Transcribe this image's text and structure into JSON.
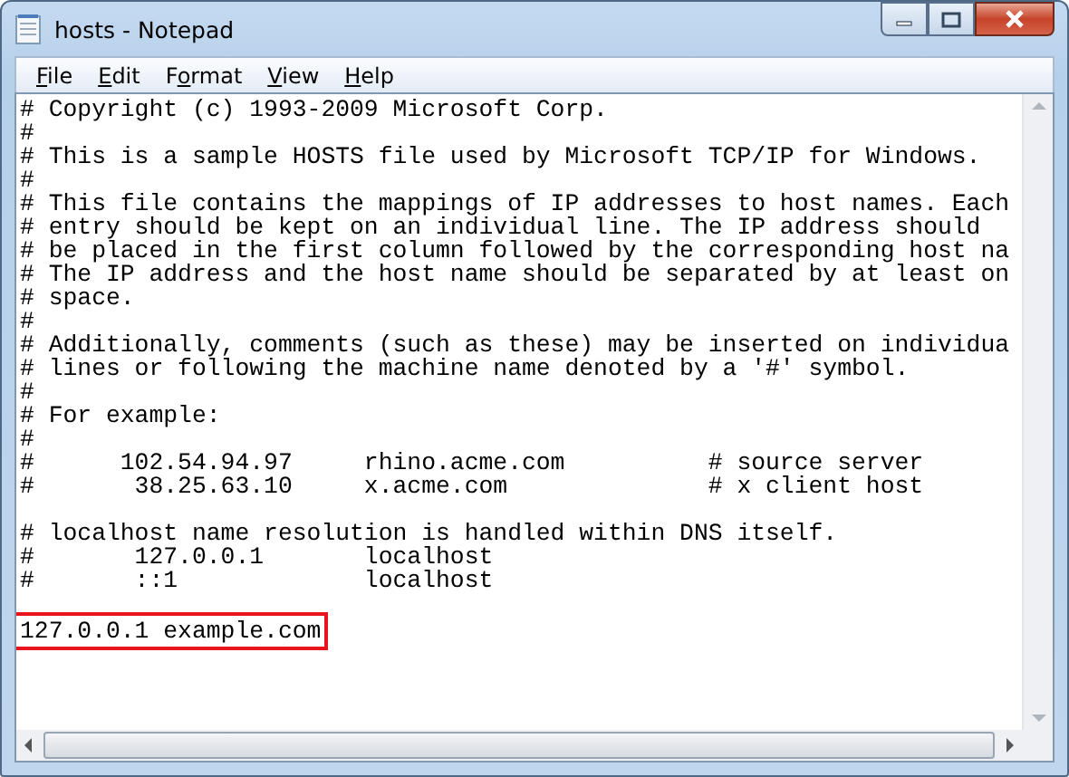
{
  "window": {
    "title": "hosts - Notepad"
  },
  "menu": [
    {
      "access_key": "F",
      "rest": "ile"
    },
    {
      "access_key": "E",
      "rest": "dit"
    },
    {
      "before": "F",
      "access_key": "o",
      "rest": "rmat"
    },
    {
      "access_key": "V",
      "rest": "iew"
    },
    {
      "access_key": "H",
      "rest": "elp"
    }
  ],
  "lines": [
    {
      "text": "# Copyright (c) 1993-2009 Microsoft Corp."
    },
    {
      "text": "#"
    },
    {
      "text": "# This is a sample HOSTS file used by Microsoft TCP/IP for Windows."
    },
    {
      "text": "#"
    },
    {
      "text": "# This file contains the mappings of IP addresses to host names. Each"
    },
    {
      "text": "# entry should be kept on an individual line. The IP address should"
    },
    {
      "text": "# be placed in the first column followed by the corresponding host na"
    },
    {
      "text": "# The IP address and the host name should be separated by at least on"
    },
    {
      "text": "# space."
    },
    {
      "text": "#"
    },
    {
      "text": "# Additionally, comments (such as these) may be inserted on individua"
    },
    {
      "text": "# lines or following the machine name denoted by a '#' symbol."
    },
    {
      "text": "#"
    },
    {
      "text": "# For example:"
    },
    {
      "text": "#"
    },
    {
      "text": "#      102.54.94.97     rhino.acme.com          # source server"
    },
    {
      "text": "#       38.25.63.10     x.acme.com              # x client host"
    },
    {
      "text": "# localhost name resolution is handled within DNS itself.",
      "blank_line_before": true
    },
    {
      "text": "#       127.0.0.1       localhost"
    },
    {
      "text": "#       ::1             localhost"
    },
    {
      "text": "127.0.0.1 example.com",
      "highlighted": true,
      "blank_line_before": true
    }
  ]
}
